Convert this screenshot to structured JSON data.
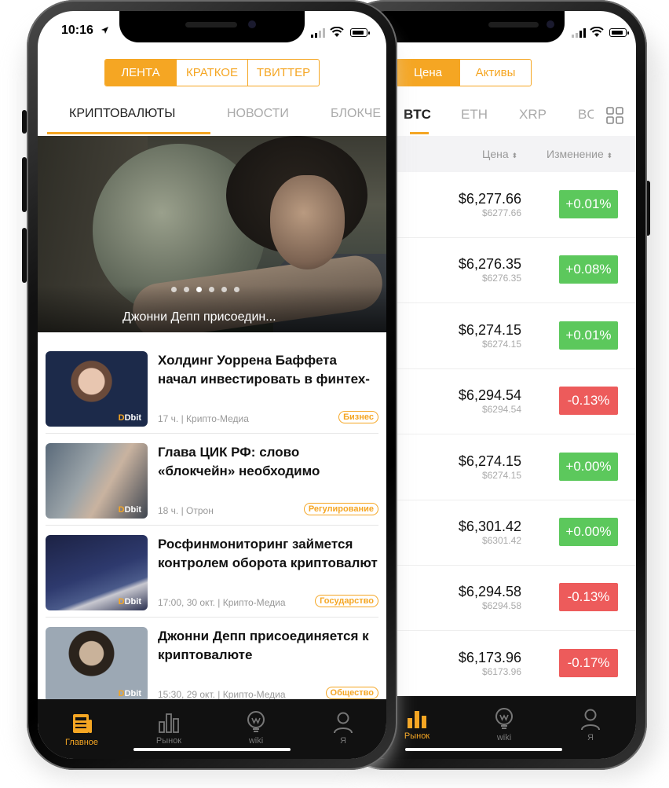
{
  "status": {
    "time": "10:16"
  },
  "left": {
    "segments": [
      {
        "label": "ЛЕНТА",
        "active": true
      },
      {
        "label": "КРАТКОЕ",
        "active": false
      },
      {
        "label": "ТВИТТЕР",
        "active": false
      }
    ],
    "tabs": [
      "КРИПТОВАЛЮТЫ",
      "НОВОСТИ",
      "БЛОКЧЕ"
    ],
    "hero_caption": "Джонни Депп присоедин...",
    "news": [
      {
        "title": "Холдинг Уоррена Баффета начал инвестировать в финтех-ста...",
        "meta": "17 ч. | Крипто-Медиа",
        "badge": "Бизнес"
      },
      {
        "title": "Глава ЦИК РФ: слово «блокчейн» необходимо заменить из-за м...",
        "meta": "18 ч. | Отрон",
        "badge": "Регулирование"
      },
      {
        "title": "Росфинмониторинг займется контролем оборота криптовалют",
        "meta": "17:00, 30 окт. | Крипто-Медиа",
        "badge": "Государство"
      },
      {
        "title": "Джонни Депп присоединяется к криптовалюте",
        "meta": "15:30, 29 окт. | Крипто-Медиа",
        "badge": "Общество"
      }
    ],
    "thumb_logo": "Dbit",
    "tabbar": [
      "Главное",
      "Рынок",
      "wiki",
      "Я"
    ]
  },
  "right": {
    "segments": [
      {
        "label": "Цена",
        "active": true
      },
      {
        "label": "Активы",
        "active": false
      }
    ],
    "tabs": [
      "BTC",
      "ETH",
      "XRP",
      "BC"
    ],
    "header": {
      "price": "Цена",
      "change": "Изменение"
    },
    "rows": [
      {
        "price": "$6,277.66",
        "sub": "$6277.66",
        "change": "+0.01%",
        "dir": "up"
      },
      {
        "price": "$6,276.35",
        "sub": "$6276.35",
        "change": "+0.08%",
        "dir": "up"
      },
      {
        "price": "$6,274.15",
        "sub": "$6274.15",
        "change": "+0.01%",
        "dir": "up"
      },
      {
        "price": "$6,294.54",
        "sub": "$6294.54",
        "change": "-0.13%",
        "dir": "dn"
      },
      {
        "price": "$6,274.15",
        "sub": "$6274.15",
        "change": "+0.00%",
        "dir": "up"
      },
      {
        "price": "$6,301.42",
        "sub": "$6301.42",
        "change": "+0.00%",
        "dir": "up"
      },
      {
        "price": "$6,294.58",
        "sub": "$6294.58",
        "change": "-0.13%",
        "dir": "dn"
      },
      {
        "price": "$6,173.96",
        "sub": "$6173.96",
        "change": "-0.17%",
        "dir": "dn"
      }
    ],
    "tabbar": [
      "Рынок",
      "wiki",
      "Я"
    ]
  },
  "colors": {
    "accent": "#f5a623",
    "up": "#5cc85c",
    "down": "#ed5b5b"
  }
}
